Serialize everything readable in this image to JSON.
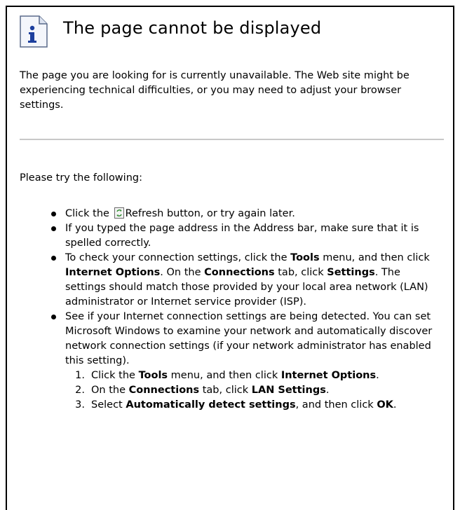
{
  "title": "The page cannot be displayed",
  "intro": "The page you are looking for is currently unavailable. The Web site might be experiencing technical difficulties, or you may need to adjust your browser settings.",
  "try_heading": "Please try the following:",
  "bullets": {
    "b1": {
      "pre": "Click the",
      "post": "Refresh button, or try again later."
    },
    "b2": {
      "text": "If you typed the page address in the Address bar, make sure that it is spelled correctly."
    },
    "b3": {
      "t1": "To check your connection settings, click the ",
      "tools": "Tools",
      "t2": " menu, and then click ",
      "internet_options": "Internet Options",
      "t3": ". On the ",
      "connections": "Connections",
      "t4": " tab, click ",
      "settings": "Settings",
      "t5": ". The settings should match those provided by your local area network (LAN) administrator or Internet service provider (ISP)."
    },
    "b4": {
      "text": "See if your Internet connection settings are being detected. You can set Microsoft Windows to examine your network and automatically discover network connection settings (if your network administrator has enabled this setting).",
      "steps": {
        "s1": {
          "num": "1.",
          "t1": "Click the ",
          "tools": "Tools",
          "t2": " menu, and then click ",
          "internet_options": "Internet Options",
          "t3": "."
        },
        "s2": {
          "num": "2.",
          "t1": "On the ",
          "connections": "Connections",
          "t2": " tab, click ",
          "lan_settings": "LAN Settings",
          "t3": "."
        },
        "s3": {
          "num": "3.",
          "t1": "Select ",
          "auto_detect": "Automatically detect settings",
          "t2": ", and then click ",
          "ok": "OK",
          "t3": "."
        }
      }
    }
  },
  "icons": {
    "header": "info-icon",
    "refresh": "refresh-icon"
  }
}
